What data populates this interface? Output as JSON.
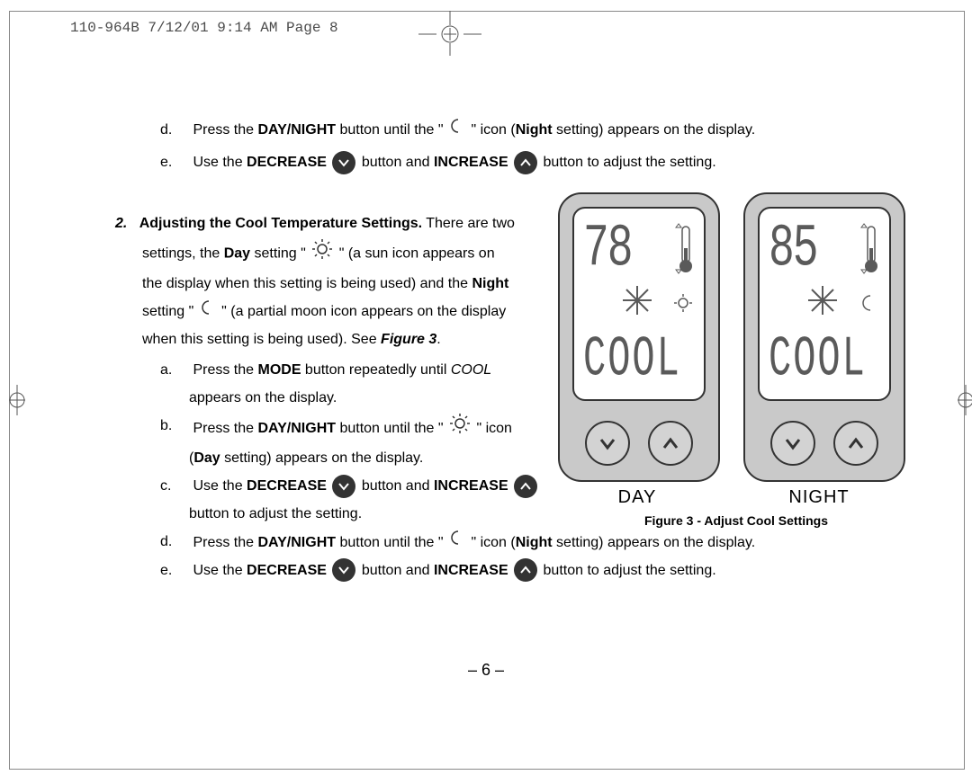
{
  "header": "110-964B  7/12/01  9:14 AM  Page 8",
  "steps": {
    "d1_bullet": "d.",
    "d1_pre": "Press the ",
    "d1_btn": "DAY/NIGHT",
    "d1_mid": " button until the \"",
    "d1_mid2": "\"  icon (",
    "d1_night": "Night",
    "d1_post": " setting) appears on the display.",
    "e1_bullet": "e.",
    "e1_pre": "Use the ",
    "e1_dec": "DECREASE",
    "e1_mid": " button and ",
    "e1_inc": "INCREASE",
    "e1_post": " button to adjust the setting."
  },
  "section2": {
    "num": "2.",
    "title": "Adjusting the Cool Temperature Settings.",
    "intro1": " There are two",
    "intro2a": "settings, the ",
    "intro2_day": "Day",
    "intro2b": " setting \"",
    "intro2c": "\" (a sun icon appears on",
    "intro3": "the display when this setting is being used) and the ",
    "intro3_night": "Night",
    "intro4a": "setting \"",
    "intro4b": "\" (a partial moon icon appears on the display",
    "intro5a": "when this setting is being used). See ",
    "intro5_fig": "Figure 3",
    "intro5b": ".",
    "a_bullet": "a.",
    "a_pre": "Press the ",
    "a_mode": "MODE",
    "a_mid": " button repeatedly until ",
    "a_cool": "COOL",
    "a_post": "appears on the display.",
    "b_bullet": "b.",
    "b_pre": "Press the ",
    "b_btn": "DAY/NIGHT",
    "b_mid": " button until the \"",
    "b_mid2": "\" icon",
    "b_line2a": "(",
    "b_day": "Day",
    "b_line2b": " setting) appears on the display.",
    "c_bullet": "c.",
    "c_pre": "Use the ",
    "c_dec": "DECREASE",
    "c_mid": " button and ",
    "c_inc": "INCREASE",
    "c_line2": "button to adjust the setting.",
    "d2_bullet": "d.",
    "d2_pre": "Press the ",
    "d2_btn": "DAY/NIGHT",
    "d2_mid": " button until the \"",
    "d2_mid2": "\"  icon (",
    "d2_night": "Night",
    "d2_post": " setting) appears on the display.",
    "e2_bullet": "e.",
    "e2_pre": "Use the ",
    "e2_dec": "DECREASE",
    "e2_mid": " button and ",
    "e2_inc": "INCREASE",
    "e2_post": " button to adjust the setting."
  },
  "figure": {
    "day_temp": "78",
    "day_mode": "COOL",
    "night_temp": "85",
    "night_mode": "COOL",
    "day_label": "DAY",
    "night_label": "NIGHT",
    "caption": "Figure 3 - Adjust Cool Settings"
  },
  "page_number": "– 6 –"
}
